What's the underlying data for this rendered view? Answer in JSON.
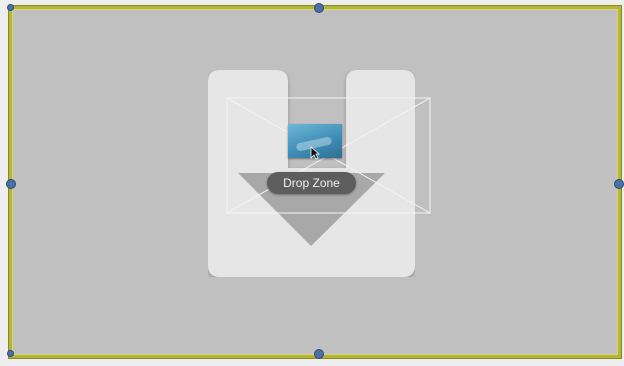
{
  "drop_zone": {
    "label": "Drop Zone",
    "icon": "drop-zone-tray-icon",
    "thumbnail_icon": "image-thumbnail-icon",
    "cursor_icon": "pointer-cursor-icon"
  },
  "colors": {
    "canvas_background": "#c0c0c0",
    "selection_border": "#b5b53a",
    "handle": "#4d6fa3",
    "label_background": "#5d5d5d",
    "label_text": "#f2f2f2",
    "icon_fill": "#e6e6e6"
  }
}
